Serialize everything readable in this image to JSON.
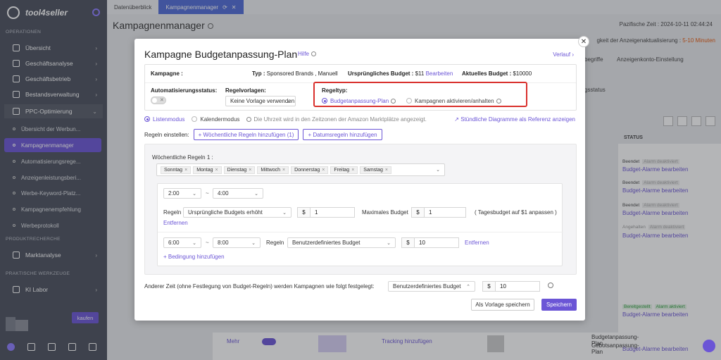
{
  "sidebar": {
    "brand": "tool4seller",
    "sections": {
      "operationen": "OPERATIONEN",
      "produktrecherche": "PRODUKTRECHERCHE",
      "praktische": "PRAKTISCHE WERKZEUGE"
    },
    "items": {
      "uebersicht": "Übersicht",
      "geschaeftsanalyse": "Geschäftsanalyse",
      "geschaeftsbetrieb": "Geschäftsbetrieb",
      "bestandsverwaltung": "Bestandsverwaltung",
      "ppc": "PPC-Optimierung",
      "marktanalyse": "Marktanalyse",
      "ki_labor": "KI Labor"
    },
    "sub": {
      "s1": "Übersicht der Werbun...",
      "s2": "Kampagnenmanager",
      "s3": "Automatisierungsrege...",
      "s4": "Anzeigenleistungsberi...",
      "s5": "Werbe-Keyword-Platz...",
      "s6": "Kampagnenempfehlung",
      "s7": "Werbeprotokoll"
    },
    "kaufen": "kaufen"
  },
  "tabs": {
    "t1": "Datenüberblick",
    "t2": "Kampagnenmanager"
  },
  "main": {
    "title": "Kampagnenmanager",
    "time": "Pazifische Zeit : 2024-10-11 02:44:24",
    "update_prefix": "gkeit der Anzeigenaktualisierung : ",
    "update_value": "5-10 Minuten",
    "right_labels": {
      "begriffe": "begriffe",
      "konto": "Anzeigenkonto-Einstellung",
      "sstatus": "gsstatus",
      "status": "STATUS"
    },
    "row_status": {
      "beendet": "Beendet",
      "alarm_deakt": "Alarm deaktiviert",
      "angehalten": "Angehalten",
      "bereitgestellt": "Bereitgestellt",
      "alarm_akt": "Alarm aktiviert",
      "budget_alarme": "Budget-Alarme bearbeiten",
      "bearbeiten": "bearbeiten",
      "gen": "gen",
      "ebeiten": "eiten",
      "mehr": "Mehr",
      "tracking": "Tracking hinzufügen",
      "gebot_plan": "Gebotsanpassung-Plan",
      "budget_plan": "Budgetanpassung-Plan",
      "regel_einst": "Regel Einstellungen",
      "bearbeiten2": "Bearbeiten"
    }
  },
  "modal": {
    "title": "Kampagne Budgetanpassung-Plan",
    "help": "Hilfe",
    "verlauf": "Verlauf ›",
    "kampagne_label": "Kampagne :",
    "typ_label": "Typ :",
    "typ_value": "Sponsored Brands , Manuell",
    "budget_label": "Ursprüngliches Budget :",
    "budget_value": "$11",
    "budget_link": "Bearbeiten",
    "aktuell_label": "Aktuelles Budget :",
    "aktuell_value": "$10000",
    "auto_label": "Automatisierungsstatus:",
    "vorlagen_label": "Regelvorlagen:",
    "vorlagen_value": "Keine Vorlage verwenden",
    "regeltyp_label": "Regeltyp:",
    "regeltyp_opt1": "Budgetanpassung-Plan",
    "regeltyp_opt2": "Kampagnen aktivieren/anhalten",
    "listenmodus": "Listenmodus",
    "kalendermodus": "Kalendermodus",
    "timezone_note": "Die Uhrzeit wird in den Zeitzonen der Amazon Marktplätze angezeigt.",
    "ref_link": "Stündliche Diagramme als Referenz anzeigen",
    "regeln_einstellen": "Regeln einstellen:",
    "add_weekly": "+ Wöchentliche Regeln hinzufügen (1)",
    "add_date": "+ Datumsregeln hinzufügen",
    "weekly_title": "Wöchentliche Regeln 1 :",
    "days": [
      "Sonntag",
      "Montag",
      "Dienstag",
      "Mittwoch",
      "Donnerstag",
      "Freitag",
      "Samstag"
    ],
    "r1_from": "2:00",
    "r1_to": "4:00",
    "regeln": "Regeln",
    "r1_select": "Ursprüngliche Budgets erhöht",
    "dollar": "$",
    "r1_value": "1",
    "max_budget_label": "Maximales Budget",
    "max_budget_value": "1",
    "tagesbudget_note": "( Tagesbudget auf $1 anpassen )",
    "entfernen": "Entfernen",
    "r2_from": "6:00",
    "r2_to": "8:00",
    "r2_select": "Benutzerdefiniertes Budget",
    "r2_value": "10",
    "add_condition": "+ Bedingung hinzufügen",
    "other_time": "Anderer Zeit (ohne Festlegung von Budget-Regeln) werden Kampagnen wie folgt festgelegt:",
    "other_select": "Benutzerdefiniertes Budget",
    "other_value": "10",
    "btn_vorlage": "Als Vorlage speichern",
    "btn_save": "Speichern"
  }
}
